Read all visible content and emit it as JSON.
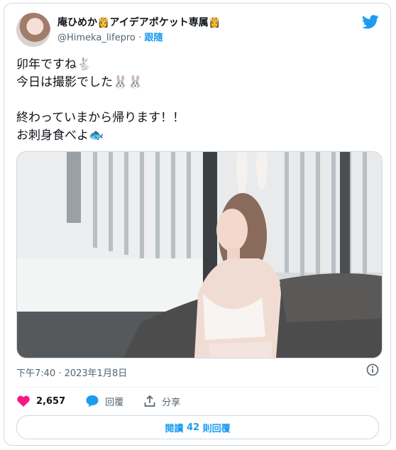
{
  "author": {
    "name": "庵ひめか👸アイデアポケット専属👸",
    "handle": "@Himeka_lifepro",
    "separator": "·",
    "follow_label": "跟隨"
  },
  "tweet": {
    "lines": [
      "卯年ですね🐇",
      "今日は撮影でした🐰🐰",
      "",
      "終わっていまから帰ります！！",
      "お刺身食べよ🐟"
    ]
  },
  "timestamp": "下午7:40 · 2023年1月8日",
  "actions": {
    "likes": "2,657",
    "reply_label": "回覆",
    "share_label": "分享"
  },
  "replies_button": {
    "prefix": "閱讀",
    "count": "42",
    "suffix": "則回覆"
  },
  "colors": {
    "accent": "#1d9bf0",
    "like": "#f91880",
    "border": "#cfd9de",
    "muted": "#536471"
  }
}
